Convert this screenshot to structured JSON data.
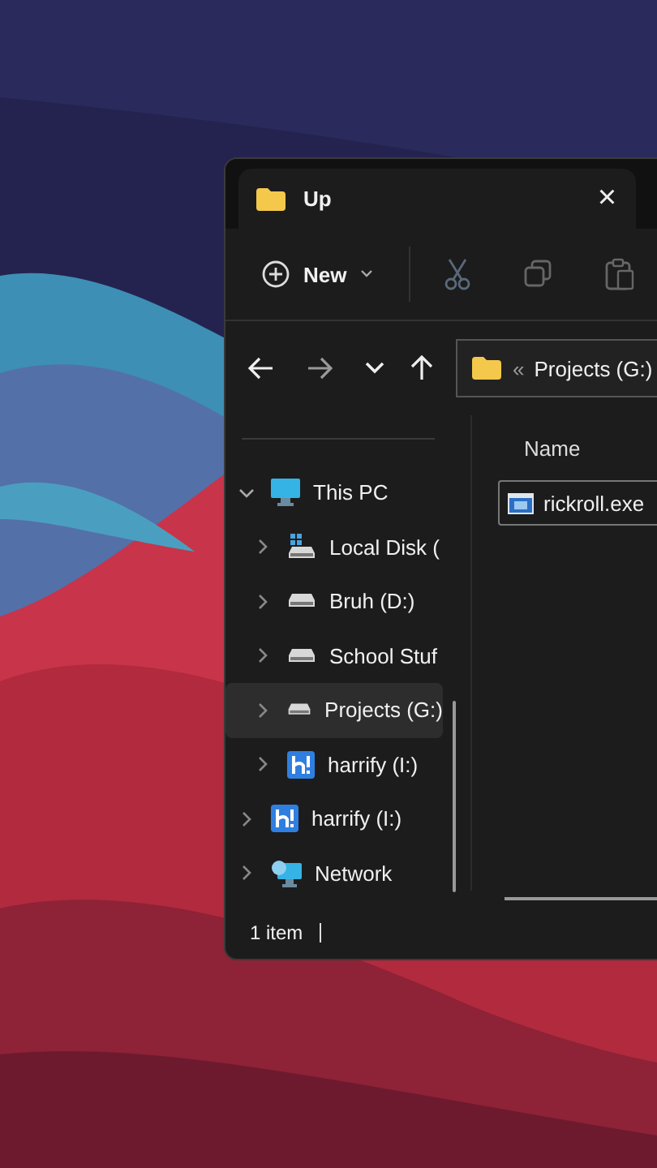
{
  "window": {
    "tab": {
      "title": "Up",
      "close": "×"
    }
  },
  "toolbar": {
    "new_label": "New"
  },
  "address": {
    "chevrons": "«",
    "path": "Projects (G:)"
  },
  "nav": [
    {
      "kind": "pc",
      "label": "This PC",
      "expanded": true,
      "selected": false,
      "children": [
        {
          "kind": "os-disk",
          "label": "Local Disk (",
          "expanded": false,
          "selected": false
        },
        {
          "kind": "disk",
          "label": "Bruh (D:)",
          "expanded": false,
          "selected": false
        },
        {
          "kind": "disk",
          "label": "School Stuf",
          "expanded": false,
          "selected": false
        },
        {
          "kind": "disk",
          "label": "Projects (G:)",
          "expanded": false,
          "selected": true
        },
        {
          "kind": "usb",
          "label": "harrify (I:)",
          "expanded": false,
          "selected": false
        }
      ]
    },
    {
      "kind": "usb",
      "label": "harrify (I:)",
      "expanded": false,
      "selected": false
    },
    {
      "kind": "network",
      "label": "Network",
      "expanded": false,
      "selected": false
    }
  ],
  "files": {
    "column": "Name",
    "items": [
      {
        "name": "rickroll.exe",
        "selected": true
      }
    ]
  },
  "status_bar": {
    "count": "1 item"
  }
}
